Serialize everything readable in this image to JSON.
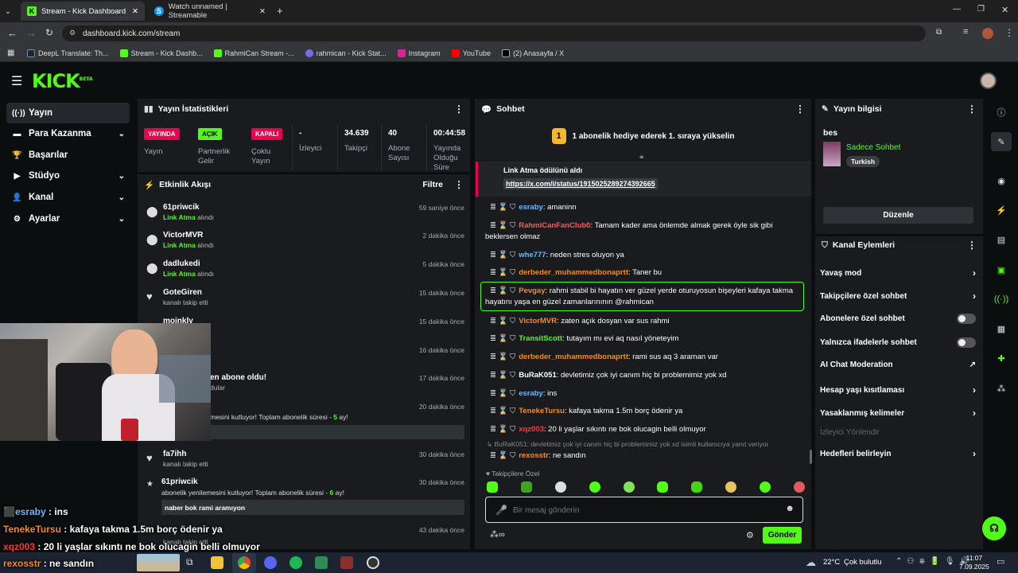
{
  "browser": {
    "tabs": [
      {
        "title": "Stream - Kick Dashboard"
      },
      {
        "title": "Watch unnamed | Streamable"
      }
    ],
    "url": "dashboard.kick.com/stream",
    "bookmarks": [
      "DeepL Translate: Th...",
      "Stream - Kick Dashb...",
      "RahmiCan Stream -...",
      "rahmican - Kick Stat...",
      "Instagram",
      "YouTube",
      "(2) Anasayfa / X"
    ]
  },
  "kick": {
    "logo": "KICK",
    "beta": "BETA"
  },
  "sidebar": {
    "items": [
      {
        "label": "Yayın"
      },
      {
        "label": "Para Kazanma"
      },
      {
        "label": "Başarılar"
      },
      {
        "label": "Stüdyo"
      },
      {
        "label": "Kanal"
      },
      {
        "label": "Ayarlar"
      }
    ]
  },
  "stats": {
    "title": "Yayın İstatistikleri",
    "yayin_badge": "YAYINDA",
    "yayin_label": "Yayın",
    "partner_badge": "AÇIK",
    "partner_label": "Partnerlik Gelir",
    "multi_badge": "KAPALI",
    "multi_label": "Çoklu Yayın",
    "viewers_value": "-",
    "viewers_label": "İzleyici",
    "followers_value": "34.639",
    "followers_label": "Takipçi",
    "subs_value": "40",
    "subs_label": "Abone Sayısı",
    "uptime_value": "00:44:58",
    "uptime_label": "Yayında Olduğu Süre"
  },
  "activity": {
    "title": "Etkinlik Akışı",
    "filter": "Filtre",
    "events": [
      {
        "user": "61priwcik",
        "desc_hl": "Link Atma",
        "desc": "alındı",
        "time": "59 saniye önce"
      },
      {
        "user": "VictorMVR",
        "desc_hl": "Link Atma",
        "desc": "alındı",
        "time": "2 dakika önce"
      },
      {
        "user": "dadlukedi",
        "desc_hl": "Link Atma",
        "desc": "alındı",
        "time": "5 dakika önce"
      },
      {
        "user": "GoteGiren",
        "desc_hl": "",
        "desc": "kanalı takip etti",
        "time": "15 dakika önce"
      },
      {
        "user": "mojnkly",
        "desc_hl": "",
        "desc": "",
        "time": "15 dakika önce"
      },
      {
        "user": "",
        "desc_hl": "",
        "desc": "",
        "time": "16 dakika önce"
      },
      {
        "user": "en abone oldu!",
        "desc_hl": "",
        "desc": "dular",
        "time": "17 dakika önce"
      },
      {
        "user": "",
        "desc_hl": "",
        "desc": "",
        "time": "20 dakika önce"
      },
      {
        "user": "fa7ihh",
        "desc_hl": "",
        "desc": "kanalı takip etti",
        "time": "30 dakika önce"
      },
      {
        "user": "61priwcik",
        "desc_hl": "",
        "desc": "abonelik yenilemesini kutluyor! Toplam abonelik süresi -",
        "time": "30 dakika önce"
      },
      {
        "user": "",
        "desc_hl": "",
        "desc": "kanalı takip etti",
        "time": "43 dakika önce"
      }
    ],
    "resub1_text": "mesini kutluyor! Toplam abonelik süresi -",
    "resub1_months": "5",
    "resub_suffix": "ay!",
    "resub2_months": "6",
    "resub2_quote": "naber bok rami aramıyon"
  },
  "chat": {
    "title": "Sohbet",
    "pinned_num": "1",
    "pinned_text": "1 abonelik hediye ederek 1. sıraya yükselin",
    "reward_text": "Link Atma ödülünü aldı",
    "reward_link": "https://x.com/i/status/1915025289274392665",
    "messages": [
      {
        "user": "esraby",
        "text": ": amaninn",
        "color": "#6bb8ff"
      },
      {
        "user": "RahmiCanFanClub0",
        "text": ": Tamam kader ama önlemde almak gerek öyle sik gibi beklersen olmaz",
        "color": "#ff5a5a"
      },
      {
        "user": "whe777",
        "text": ": neden stres oluyon ya",
        "color": "#6bb8ff"
      },
      {
        "user": "derbeder_muhammedbonaprtt",
        "text": ": Taner bu",
        "color": "#f28c28"
      },
      {
        "user": "Pevgay",
        "text": ": rahmi stabil bi hayatın ver güzel yerde oturuyosun bişeyleri kafaya takma hayatını yaşa en güzel zamanlarınının @rahmican",
        "color": "#f28c28"
      },
      {
        "user": "VictorMVR",
        "text": ": zaten açık dosyan var sus rahmi",
        "color": "#f28c28"
      },
      {
        "user": "TransitScott",
        "text": ": tutayım mı evi aq nasıl yöneteyim",
        "color": "#53fc18"
      },
      {
        "user": "derbeder_muhammedbonaprtt",
        "text": ": rami sus aq 3 araman var",
        "color": "#f28c28"
      },
      {
        "user": "BuRaK051",
        "text": ": devletimiz çok iyi canım hiç bi problemimiz yok xd",
        "color": "#ffffff"
      },
      {
        "user": "esraby",
        "text": ": ins",
        "color": "#6bb8ff"
      },
      {
        "user": "TenekeTursu",
        "text": ": kafaya takma 1.5m borç ödenir ya",
        "color": "#f28c28"
      },
      {
        "user": "xqz003",
        "text": ": 20 li yaşlar sıkıntı ne bok olucagin belli olmuyor",
        "color": "#ff3b3b"
      }
    ],
    "reply_ref": "BuRaK051: devletimiz çok iyi canım hiç bi problemimiz yok xd isimli kullanıcıya yanıt veriyor",
    "reply_user": "rexosstr",
    "reply_text": ": ne sandın",
    "followers_only": "Takipçilere Özel",
    "input_placeholder": "Bir mesaj gönderin",
    "send": "Gönder"
  },
  "stream_info": {
    "title": "Yayın bilgisi",
    "stream_title": "bes",
    "category": "Sadece Sohbet",
    "language": "Turkish",
    "edit": "Düzenle"
  },
  "channel_actions": {
    "title": "Kanal Eylemleri",
    "items": [
      {
        "label": "Yavaş mod"
      },
      {
        "label": "Takipçilere özel sohbet"
      },
      {
        "label": "Abonelere özel sohbet"
      },
      {
        "label": "Yalnızca ifadelerle sohbet"
      },
      {
        "label": "AI Chat Moderation"
      },
      {
        "label": "Hesap yaşı kısıtlaması"
      },
      {
        "label": "Yasaklanmış kelimeler"
      },
      {
        "label": "İzleyici Yönlendir"
      },
      {
        "label": "Hedefleri belirleyin"
      }
    ]
  },
  "overlay_chat": [
    {
      "user": "esraby",
      "text": " : ins",
      "color": "#6bb8ff"
    },
    {
      "user": "TenekeTursu",
      "text": " : kafaya takma 1.5m borç ödenir ya",
      "color": "#f28c28"
    },
    {
      "user": "xqz003",
      "text": " : 20 li yaşlar sıkıntı ne bok olucagin belli olmuyor",
      "color": "#ff3b3b"
    },
    {
      "user": "rexosstr",
      "text": " : ne sandın",
      "color": "#f28c28"
    }
  ],
  "taskbar": {
    "temp": "22°C",
    "weather": "Çok bulutlu",
    "time": "11:07",
    "date": "7.09.2025"
  },
  "colors": {
    "accent": "#53fc18",
    "panel": "#191b1f",
    "bg": "#0b0e0f"
  }
}
